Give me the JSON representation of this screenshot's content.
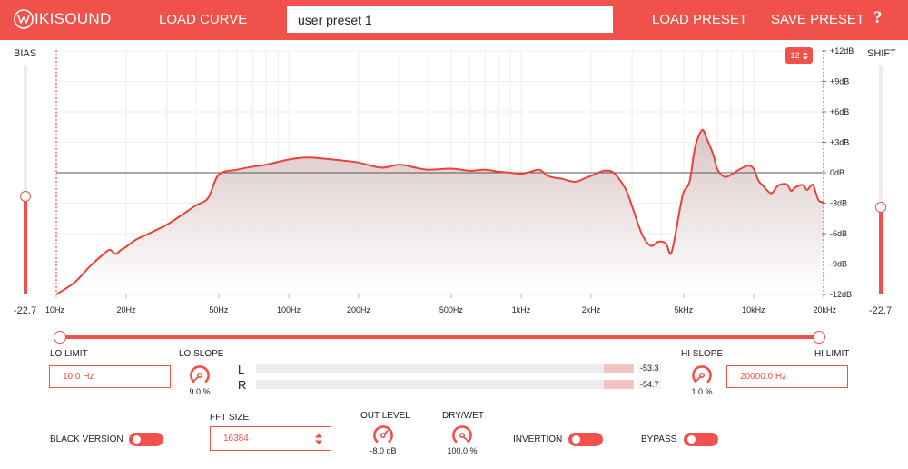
{
  "header": {
    "logo_text": "IKISOUND",
    "load_curve": "LOAD CURVE",
    "preset_name": "user preset 1",
    "load_preset": "LOAD PRESET",
    "save_preset": "SAVE PRESET",
    "help": "?"
  },
  "bias": {
    "label": "BIAS",
    "value": "-22.7"
  },
  "shift": {
    "label": "SHIFT",
    "value": "-22.7"
  },
  "graph": {
    "resolution": "12",
    "db_labels": [
      "+12dB",
      "+9dB",
      "+6dB",
      "+3dB",
      "0dB",
      "-3dB",
      "-6dB",
      "-9dB",
      "-12dB"
    ],
    "freq_labels": [
      "10Hz",
      "20Hz",
      "50Hz",
      "100Hz",
      "200Hz",
      "500Hz",
      "1kHz",
      "2kHz",
      "5kHz",
      "10kHz",
      "20kHz"
    ],
    "curve_color": "#e8423b",
    "fill_color": "#dcc9c9"
  },
  "chart_data": {
    "type": "line",
    "x_scale": "log",
    "xlim": [
      10,
      20000
    ],
    "ylim": [
      -12,
      12
    ],
    "x_unit": "Hz",
    "y_unit": "dB",
    "series": [
      {
        "x": [
          10,
          12,
          14,
          16,
          17,
          18,
          19,
          20,
          22,
          25,
          30,
          35,
          40,
          45,
          50,
          60,
          70,
          80,
          100,
          120,
          140,
          170,
          200,
          250,
          300,
          350,
          400,
          500,
          600,
          700,
          800,
          900,
          1000,
          1100,
          1200,
          1300,
          1400,
          1500,
          1700,
          1900,
          2000,
          2200,
          2300,
          2500,
          2800,
          3000,
          3300,
          3600,
          3900,
          4200,
          4400,
          4600,
          4800,
          5000,
          5300,
          5600,
          6000,
          6300,
          6700,
          7000,
          7500,
          8000,
          8500,
          9000,
          9500,
          10000,
          10500,
          11000,
          11500,
          12000,
          12700,
          13500,
          14000,
          14500,
          15000,
          16000,
          16500,
          17000,
          18000,
          19000,
          20000
        ],
        "y": [
          -12,
          -10.8,
          -9.2,
          -8,
          -7.6,
          -8,
          -7.6,
          -7.3,
          -6.6,
          -6,
          -5.1,
          -4.1,
          -3.2,
          -2.5,
          -0.2,
          0.3,
          0.6,
          0.8,
          1.3,
          1.5,
          1.4,
          1.2,
          1.0,
          0.5,
          0.8,
          0.5,
          0.3,
          0.4,
          0.2,
          0.3,
          0.1,
          0.0,
          -0.1,
          0.1,
          0.3,
          -0.3,
          -0.5,
          -0.6,
          -0.9,
          -0.5,
          -0.3,
          0.1,
          0.2,
          0.0,
          -1.5,
          -3.3,
          -6,
          -7.2,
          -6.8,
          -7,
          -8,
          -6.2,
          -3.8,
          -1.9,
          -0.9,
          2.5,
          4.2,
          3.3,
          1.8,
          0.3,
          -0.4,
          -0.2,
          0.2,
          0.5,
          0.7,
          0.4,
          -0.8,
          -1.3,
          -1.8,
          -2.0,
          -1.3,
          -1.1,
          -1.2,
          -1.8,
          -1.5,
          -1.2,
          -1.3,
          -1.7,
          -1.2,
          -2.7,
          -2.9
        ]
      }
    ],
    "zero_line": 0,
    "grid": true
  },
  "controls": {
    "lo_limit": {
      "label": "LO LIMIT",
      "value": "10.0 Hz"
    },
    "lo_slope": {
      "label": "LO SLOPE",
      "value": "9.0 %"
    },
    "hi_slope": {
      "label": "HI SLOPE",
      "value": "1.0 %"
    },
    "hi_limit": {
      "label": "HI LIMIT",
      "value": "20000.0 Hz"
    },
    "out_level": {
      "label": "OUT LEVEL",
      "value": "-8.0 dB"
    },
    "dry_wet": {
      "label": "DRY/WET",
      "value": "100.0 %"
    },
    "fft_size": {
      "label": "FFT SIZE",
      "value": "16384"
    },
    "black_version": {
      "label": "BLACK VERSION"
    },
    "invertion": {
      "label": "INVERTION"
    },
    "bypass": {
      "label": "BYPASS"
    }
  },
  "meters": {
    "left": {
      "label": "L",
      "value": "-53.3"
    },
    "right": {
      "label": "R",
      "value": "-54.7"
    }
  },
  "colors": {
    "accent": "#f0514a",
    "track": "#ececec",
    "grid": "#ececec"
  }
}
